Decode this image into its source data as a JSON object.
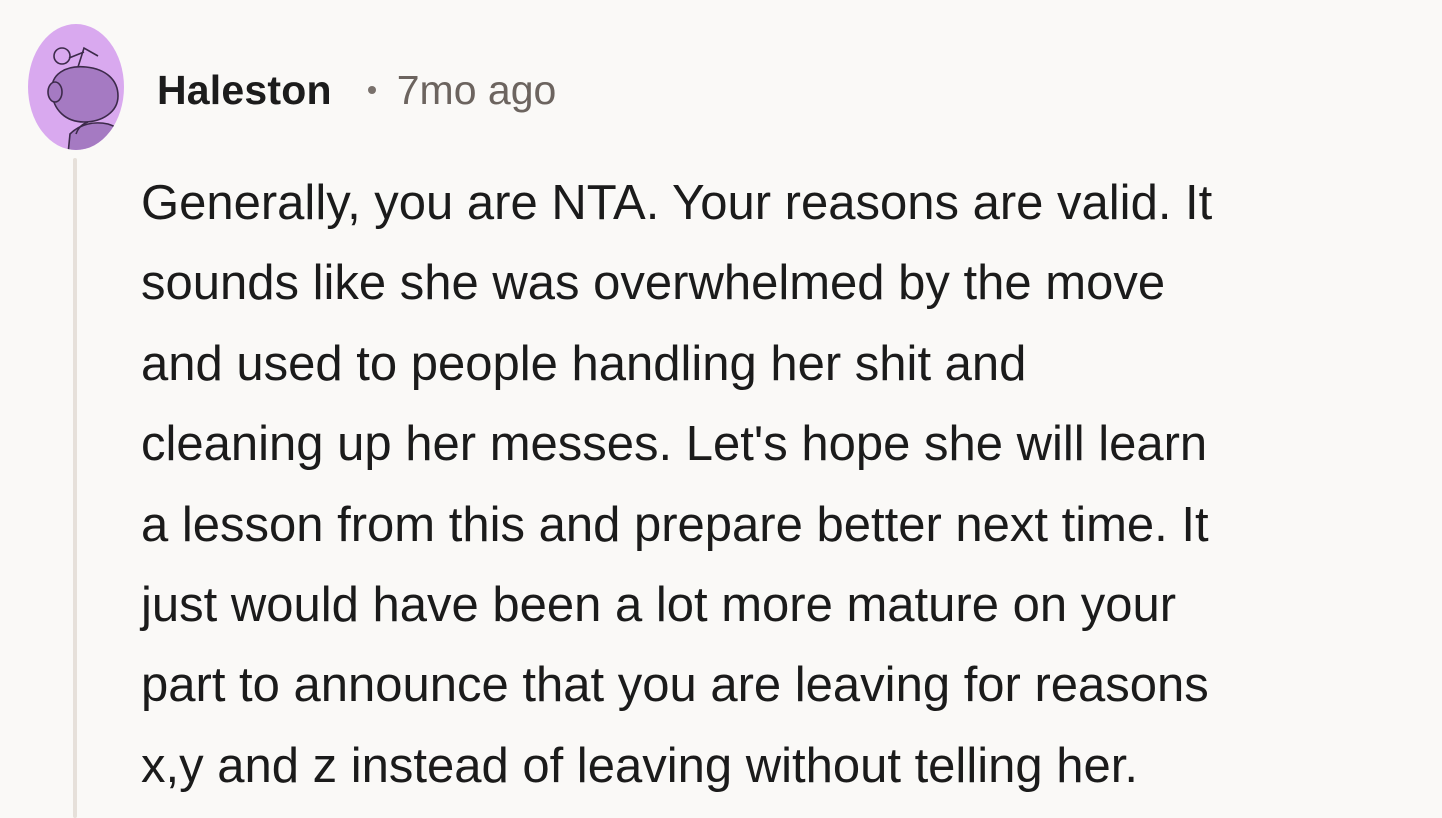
{
  "comment": {
    "author": "Haleston",
    "separator": "•",
    "timestamp": "7mo ago",
    "avatar_icon": "reddit-snoo-avatar-icon",
    "colors": {
      "avatar_background": "#d9a9ef",
      "avatar_figure": "#a57ac2",
      "thread_line": "#e6e0da",
      "page_background": "#faf9f7",
      "text": "#1b1b1b",
      "meta_text": "#6c645f"
    },
    "body_lines": [
      "Generally, you are NTA. Your reasons are valid. It",
      "sounds like she was overwhelmed by the move",
      "and used to people handling her shit and",
      "cleaning up her messes. Let's hope she will learn",
      "a lesson from this and prepare better next time. It",
      "just would have been a lot more mature on your",
      "part to announce that you are leaving for reasons",
      "x,y and z instead of leaving without telling her."
    ]
  }
}
